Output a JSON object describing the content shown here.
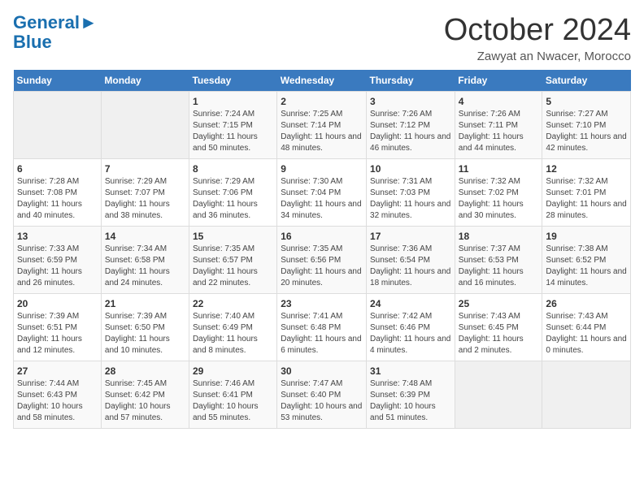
{
  "header": {
    "logo_line1": "General",
    "logo_line2": "Blue",
    "month": "October 2024",
    "location": "Zawyat an Nwacer, Morocco"
  },
  "days_of_week": [
    "Sunday",
    "Monday",
    "Tuesday",
    "Wednesday",
    "Thursday",
    "Friday",
    "Saturday"
  ],
  "weeks": [
    [
      {
        "day": "",
        "info": ""
      },
      {
        "day": "",
        "info": ""
      },
      {
        "day": "1",
        "info": "Sunrise: 7:24 AM\nSunset: 7:15 PM\nDaylight: 11 hours and 50 minutes."
      },
      {
        "day": "2",
        "info": "Sunrise: 7:25 AM\nSunset: 7:14 PM\nDaylight: 11 hours and 48 minutes."
      },
      {
        "day": "3",
        "info": "Sunrise: 7:26 AM\nSunset: 7:12 PM\nDaylight: 11 hours and 46 minutes."
      },
      {
        "day": "4",
        "info": "Sunrise: 7:26 AM\nSunset: 7:11 PM\nDaylight: 11 hours and 44 minutes."
      },
      {
        "day": "5",
        "info": "Sunrise: 7:27 AM\nSunset: 7:10 PM\nDaylight: 11 hours and 42 minutes."
      }
    ],
    [
      {
        "day": "6",
        "info": "Sunrise: 7:28 AM\nSunset: 7:08 PM\nDaylight: 11 hours and 40 minutes."
      },
      {
        "day": "7",
        "info": "Sunrise: 7:29 AM\nSunset: 7:07 PM\nDaylight: 11 hours and 38 minutes."
      },
      {
        "day": "8",
        "info": "Sunrise: 7:29 AM\nSunset: 7:06 PM\nDaylight: 11 hours and 36 minutes."
      },
      {
        "day": "9",
        "info": "Sunrise: 7:30 AM\nSunset: 7:04 PM\nDaylight: 11 hours and 34 minutes."
      },
      {
        "day": "10",
        "info": "Sunrise: 7:31 AM\nSunset: 7:03 PM\nDaylight: 11 hours and 32 minutes."
      },
      {
        "day": "11",
        "info": "Sunrise: 7:32 AM\nSunset: 7:02 PM\nDaylight: 11 hours and 30 minutes."
      },
      {
        "day": "12",
        "info": "Sunrise: 7:32 AM\nSunset: 7:01 PM\nDaylight: 11 hours and 28 minutes."
      }
    ],
    [
      {
        "day": "13",
        "info": "Sunrise: 7:33 AM\nSunset: 6:59 PM\nDaylight: 11 hours and 26 minutes."
      },
      {
        "day": "14",
        "info": "Sunrise: 7:34 AM\nSunset: 6:58 PM\nDaylight: 11 hours and 24 minutes."
      },
      {
        "day": "15",
        "info": "Sunrise: 7:35 AM\nSunset: 6:57 PM\nDaylight: 11 hours and 22 minutes."
      },
      {
        "day": "16",
        "info": "Sunrise: 7:35 AM\nSunset: 6:56 PM\nDaylight: 11 hours and 20 minutes."
      },
      {
        "day": "17",
        "info": "Sunrise: 7:36 AM\nSunset: 6:54 PM\nDaylight: 11 hours and 18 minutes."
      },
      {
        "day": "18",
        "info": "Sunrise: 7:37 AM\nSunset: 6:53 PM\nDaylight: 11 hours and 16 minutes."
      },
      {
        "day": "19",
        "info": "Sunrise: 7:38 AM\nSunset: 6:52 PM\nDaylight: 11 hours and 14 minutes."
      }
    ],
    [
      {
        "day": "20",
        "info": "Sunrise: 7:39 AM\nSunset: 6:51 PM\nDaylight: 11 hours and 12 minutes."
      },
      {
        "day": "21",
        "info": "Sunrise: 7:39 AM\nSunset: 6:50 PM\nDaylight: 11 hours and 10 minutes."
      },
      {
        "day": "22",
        "info": "Sunrise: 7:40 AM\nSunset: 6:49 PM\nDaylight: 11 hours and 8 minutes."
      },
      {
        "day": "23",
        "info": "Sunrise: 7:41 AM\nSunset: 6:48 PM\nDaylight: 11 hours and 6 minutes."
      },
      {
        "day": "24",
        "info": "Sunrise: 7:42 AM\nSunset: 6:46 PM\nDaylight: 11 hours and 4 minutes."
      },
      {
        "day": "25",
        "info": "Sunrise: 7:43 AM\nSunset: 6:45 PM\nDaylight: 11 hours and 2 minutes."
      },
      {
        "day": "26",
        "info": "Sunrise: 7:43 AM\nSunset: 6:44 PM\nDaylight: 11 hours and 0 minutes."
      }
    ],
    [
      {
        "day": "27",
        "info": "Sunrise: 7:44 AM\nSunset: 6:43 PM\nDaylight: 10 hours and 58 minutes."
      },
      {
        "day": "28",
        "info": "Sunrise: 7:45 AM\nSunset: 6:42 PM\nDaylight: 10 hours and 57 minutes."
      },
      {
        "day": "29",
        "info": "Sunrise: 7:46 AM\nSunset: 6:41 PM\nDaylight: 10 hours and 55 minutes."
      },
      {
        "day": "30",
        "info": "Sunrise: 7:47 AM\nSunset: 6:40 PM\nDaylight: 10 hours and 53 minutes."
      },
      {
        "day": "31",
        "info": "Sunrise: 7:48 AM\nSunset: 6:39 PM\nDaylight: 10 hours and 51 minutes."
      },
      {
        "day": "",
        "info": ""
      },
      {
        "day": "",
        "info": ""
      }
    ]
  ]
}
